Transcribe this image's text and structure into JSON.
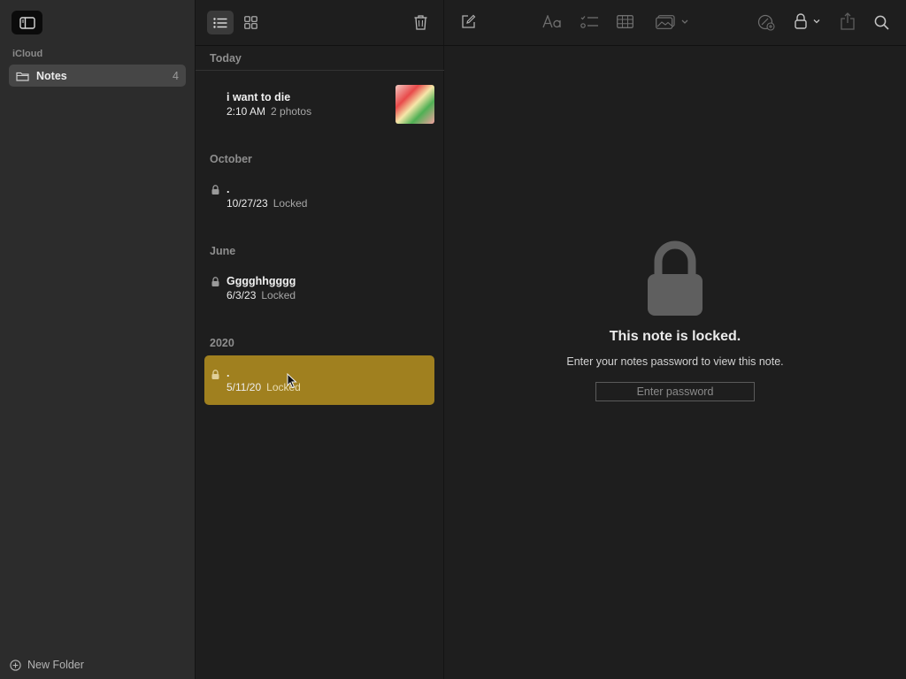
{
  "sidebar": {
    "section": "iCloud",
    "folders": [
      {
        "label": "Notes",
        "count": "4"
      }
    ],
    "new_folder": "New Folder"
  },
  "list": {
    "groups": [
      {
        "header": "Today",
        "notes": [
          {
            "title": "i want to die",
            "date": "2:10 AM",
            "detail": "2 photos",
            "locked": false,
            "has_thumbnail": true
          }
        ]
      },
      {
        "header": "October",
        "notes": [
          {
            "title": ".",
            "date": "10/27/23",
            "detail": "Locked",
            "locked": true
          }
        ]
      },
      {
        "header": "June",
        "notes": [
          {
            "title": "Gggghhgggg",
            "date": "6/3/23",
            "detail": "Locked",
            "locked": true
          }
        ]
      },
      {
        "header": "2020",
        "notes": [
          {
            "title": ".",
            "date": "5/11/20",
            "detail": "Locked",
            "locked": true,
            "selected": true
          }
        ]
      }
    ]
  },
  "detail": {
    "locked_title": "This note is locked.",
    "locked_sub": "Enter your notes password to view this note.",
    "password_placeholder": "Enter password"
  },
  "colors": {
    "selection": "#a0801f",
    "sidebar_bg": "#2c2c2c",
    "content_bg": "#1e1e1e"
  },
  "icons": [
    "sidebar-toggle-icon",
    "list-view-icon",
    "gallery-view-icon",
    "trash-icon",
    "compose-icon",
    "format-icon",
    "checklist-icon",
    "table-icon",
    "media-icon",
    "collaborate-icon",
    "lock-icon",
    "share-icon",
    "search-icon",
    "folder-icon",
    "plus-circle-icon"
  ]
}
